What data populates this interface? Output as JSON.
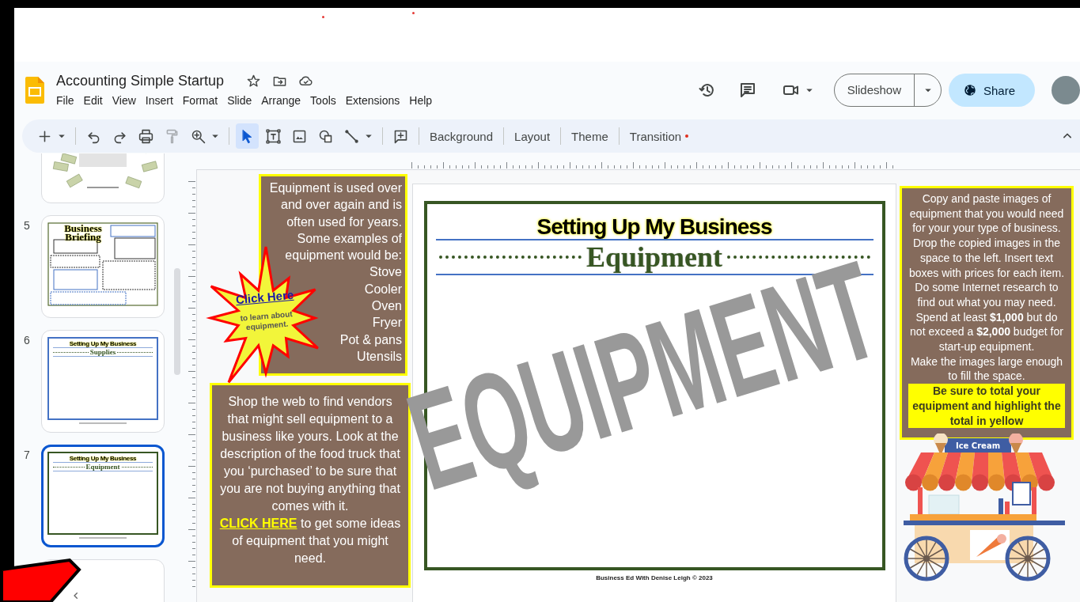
{
  "document": {
    "title": "Accounting Simple Startup"
  },
  "menu": [
    "File",
    "Edit",
    "View",
    "Insert",
    "Format",
    "Slide",
    "Arrange",
    "Tools",
    "Extensions",
    "Help"
  ],
  "header_actions": {
    "slideshow": "Slideshow",
    "share": "Share"
  },
  "toolbar": {
    "tools": [
      {
        "selected": false,
        "disabled": false
      },
      {
        "selected": false,
        "disabled": false
      },
      {
        "selected": false,
        "disabled": false
      },
      {
        "selected": false,
        "disabled": false
      },
      {
        "selected": false,
        "disabled": true
      },
      {
        "selected": false,
        "disabled": false
      },
      {
        "selected": true,
        "disabled": false
      },
      {
        "selected": false,
        "disabled": false
      },
      {
        "selected": false,
        "disabled": false
      },
      {
        "selected": false,
        "disabled": false
      },
      {
        "selected": false,
        "disabled": false
      },
      {
        "selected": false,
        "disabled": false
      }
    ],
    "buttons": [
      {
        "label": "Background",
        "notification": false
      },
      {
        "label": "Layout",
        "notification": false
      },
      {
        "label": "Theme",
        "notification": false
      },
      {
        "label": "Transition",
        "notification": true
      }
    ]
  },
  "filmstrip": {
    "slides": [
      {
        "kind": "photo",
        "selected": false
      },
      {
        "kind": "briefing",
        "number": "5",
        "title": "Business Briefing",
        "selected": false
      },
      {
        "kind": "section",
        "number": "6",
        "title": "Setting Up My Business",
        "subtitle": "Supplies",
        "color": "#4472c4",
        "selected": false
      },
      {
        "kind": "section",
        "number": "7",
        "title": "Setting Up My Business",
        "subtitle": "Equipment",
        "color": "#375623",
        "selected": true
      },
      {
        "kind": "blank",
        "selected": false
      }
    ]
  },
  "slide": {
    "intro": {
      "paragraphs": [
        "Equipment is used over and over again and is often used for years.",
        "Some examples of equipment would be:"
      ],
      "items": [
        "Stove",
        "Cooler",
        "Oven",
        "Fryer",
        "Pot & pans",
        "Utensils"
      ]
    },
    "callout": {
      "link": "Click Here",
      "text": "to learn about equipment."
    },
    "shop": {
      "before": "Shop the web to find vendors that might sell equipment to a business like yours. Look at the description of the food truck that you ‘purchased’ to be sure that you are not buying anything that comes with it.",
      "link": "CLICK HERE",
      "after": "to get some ideas of equipment that you might need."
    },
    "title": "Setting Up My Business",
    "subtitle": "Equipment",
    "footer": "Business Ed With Denise Leigh © 2023",
    "instructions": {
      "paragraphs": [
        "Copy and paste images of equipment that you would need for your your type of business. Drop the copied images in the space to the left. Insert text boxes with prices for each item. Do some Internet research to find out what you may need.",
        "Spend at least **$1,000** but do not exceed a **$2,000** budget for start-up equipment.",
        "Make the images large enough to fill the space."
      ],
      "highlight": "Be sure to total your equipment  and highlight the total in yellow"
    },
    "cart_sign": "Ice Cream"
  },
  "overlay": {
    "text": "EQUIPMENT"
  }
}
